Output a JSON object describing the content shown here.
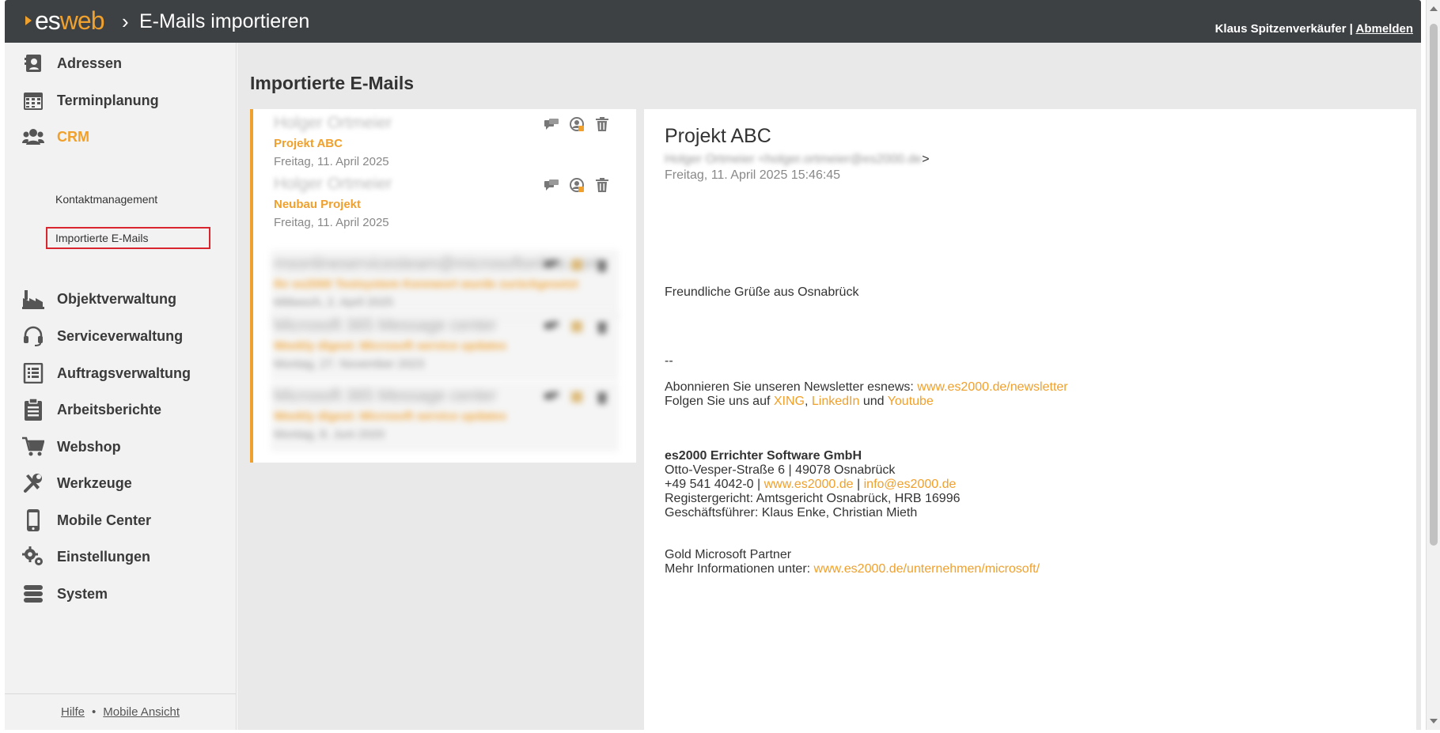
{
  "header": {
    "logo_es": "es",
    "logo_web": "web",
    "separator": "›",
    "title": "E-Mails importieren",
    "user": "Klaus Spitzenverkäufer",
    "divider": "|",
    "logout": "Abmelden"
  },
  "sidebar": {
    "items": [
      {
        "label": "Adressen",
        "icon": "address-book-icon"
      },
      {
        "label": "Terminplanung",
        "icon": "calendar-icon"
      },
      {
        "label": "CRM",
        "icon": "users-icon"
      },
      {
        "label": "Objektverwaltung",
        "icon": "factory-icon"
      },
      {
        "label": "Serviceverwaltung",
        "icon": "headset-icon"
      },
      {
        "label": "Auftragsverwaltung",
        "icon": "list-icon"
      },
      {
        "label": "Arbeitsberichte",
        "icon": "clipboard-icon"
      },
      {
        "label": "Webshop",
        "icon": "cart-icon"
      },
      {
        "label": "Werkzeuge",
        "icon": "tools-icon"
      },
      {
        "label": "Mobile Center",
        "icon": "mobile-icon"
      },
      {
        "label": "Einstellungen",
        "icon": "gears-icon"
      },
      {
        "label": "System",
        "icon": "database-icon"
      }
    ],
    "sub_items": [
      {
        "label": "Kontaktmanagement"
      },
      {
        "label": "Importierte E-Mails"
      }
    ],
    "footer": {
      "help": "Hilfe",
      "dot": "•",
      "mobile": "Mobile Ansicht"
    }
  },
  "main": {
    "title": "Importierte E-Mails",
    "mails": [
      {
        "sender": "Holger Ortmeier",
        "subject": "Projekt ABC",
        "date": "Freitag, 11. April 2025"
      },
      {
        "sender": "Holger Ortmeier",
        "subject": "Neubau Projekt",
        "date": "Freitag, 11. April 2025"
      },
      {
        "sender": "msonlineservicesteam@microsoftonline.com",
        "subject": "Ihr es2000 Testsystem Kennwort wurde zurückgesetzt",
        "date": "Mittwoch, 2. April 2025"
      },
      {
        "sender": "Microsoft 365 Message center",
        "subject": "Weekly digest: Microsoft service updates",
        "date": "Montag, 27. November 2023"
      },
      {
        "sender": "Microsoft 365 Message center",
        "subject": "Weekly digest: Microsoft service updates",
        "date": "Montag, 8. Juni 2020"
      }
    ]
  },
  "reader": {
    "subject": "Projekt ABC",
    "from_name": "Holger Ortmeier <holger.ortmeier@es2000.de",
    "from_close": ">",
    "date": "Freitag, 11. April 2025 15:46:45",
    "greeting": "Freundliche Grüße aus Osnabrück",
    "sig_sep": "--",
    "newsletter_text": "Abonnieren Sie unseren Newsletter esnews: ",
    "newsletter_link": "www.es2000.de/newsletter",
    "follow_text": "Folgen Sie uns auf ",
    "xing": "XING",
    "comma": ", ",
    "linkedin": "LinkedIn",
    "und": " und ",
    "youtube": "Youtube",
    "company": "es2000 Errichter Software GmbH",
    "address": "Otto-Vesper-Straße 6 | 49078 Osnabrück",
    "phone": "+49 541 4042-0 | ",
    "web_link": "www.es2000.de",
    "pipe": " | ",
    "mail_link": "info@es2000.de",
    "register": "Registergericht: Amtsgericht Osnabrück, HRB 16996",
    "managers": "Geschäftsführer: Klaus Enke, Christian Mieth",
    "partner": "Gold Microsoft Partner",
    "more_text": "Mehr Informationen unter: ",
    "more_link": "www.es2000.de/unternehmen/microsoft/"
  },
  "colors": {
    "accent": "#f0a02c",
    "header_bg": "#3d4143",
    "selected_border": "#d9262e"
  }
}
